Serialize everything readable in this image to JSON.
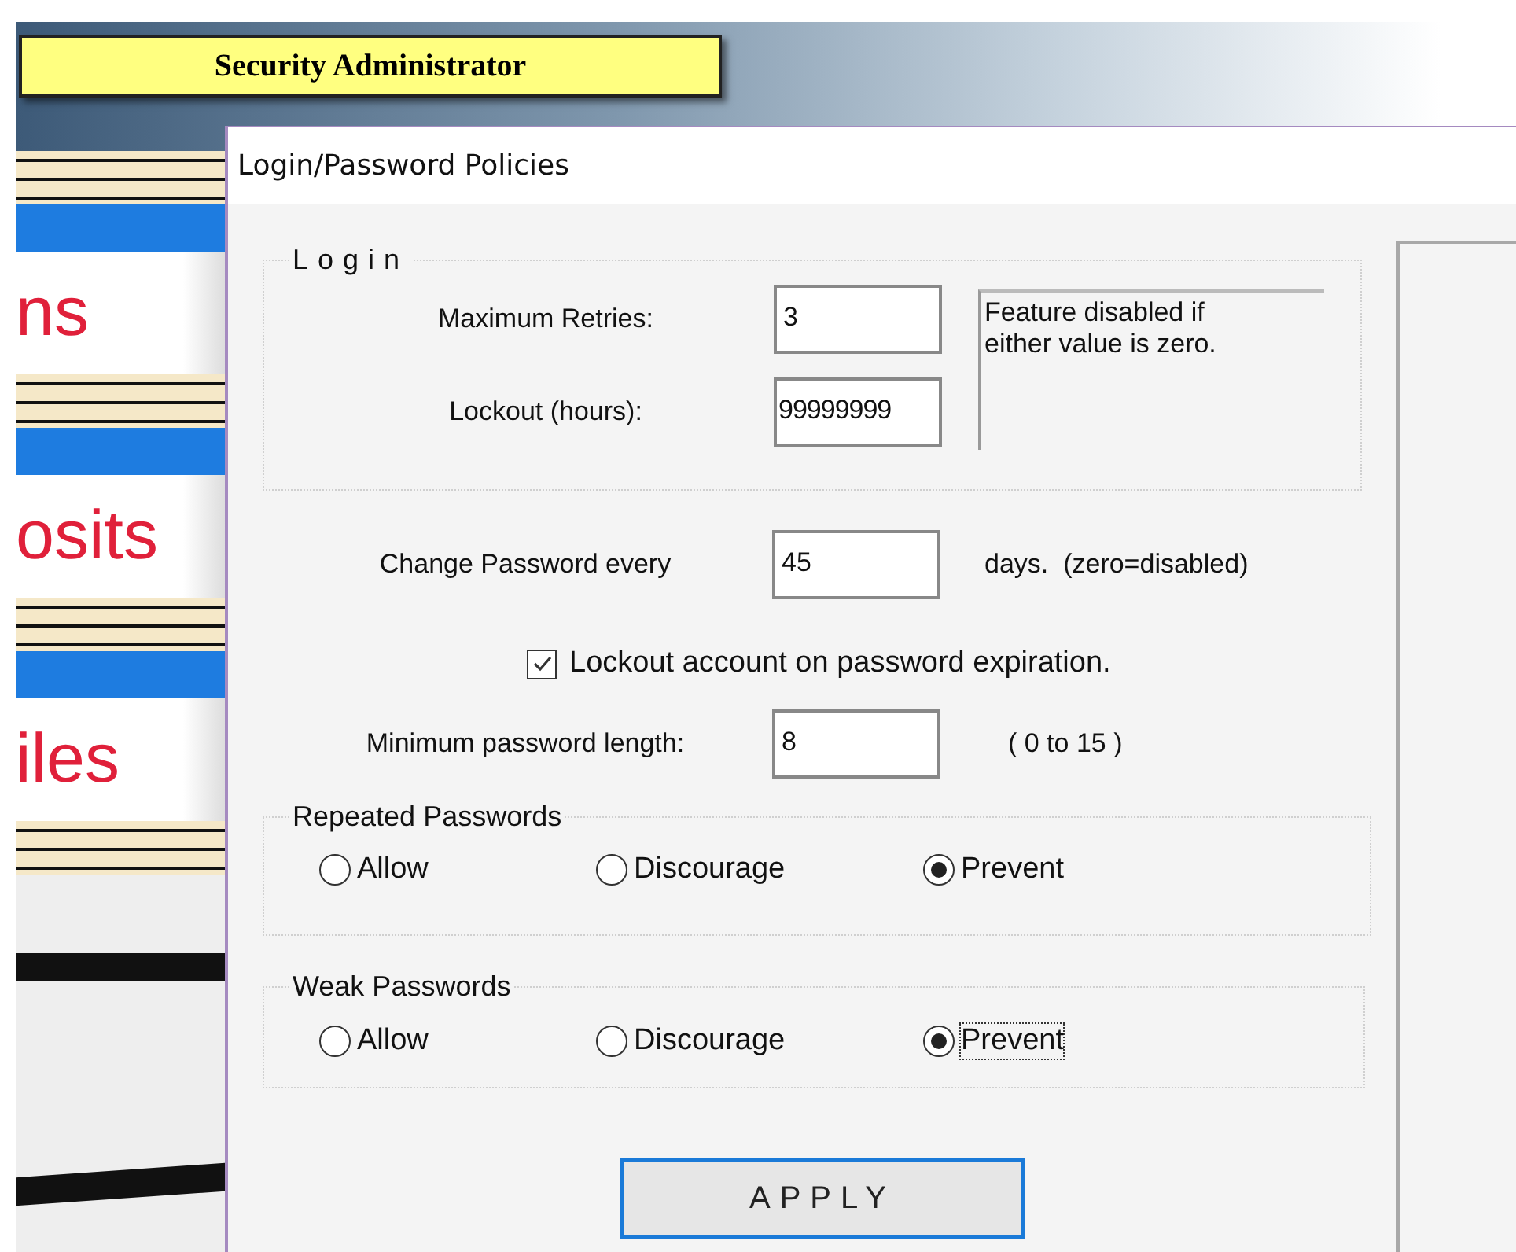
{
  "background_app": {
    "banner": "Security Administrator",
    "menu_items": [
      {
        "label": "ns"
      },
      {
        "label": "osits"
      },
      {
        "label": "iles"
      }
    ]
  },
  "dialog": {
    "title": "Login/Password Policies",
    "login_group": {
      "legend": "Login",
      "max_retries": {
        "label": "Maximum Retries:",
        "value": "3"
      },
      "lockout_hours": {
        "label": "Lockout (hours):",
        "value": "99999999"
      },
      "note": "Feature disabled if either value is zero."
    },
    "change_password": {
      "label": "Change Password every",
      "value": "45",
      "suffix": "days.  (zero=disabled)"
    },
    "lockout_on_expiration": {
      "label": "Lockout account on password expiration.",
      "checked": true
    },
    "min_length": {
      "label": "Minimum password length:",
      "value": "8",
      "hint": "( 0 to 15 )"
    },
    "radio_groups": [
      {
        "legend": "Repeated Passwords",
        "options": [
          {
            "label": "Allow",
            "selected": false,
            "focused": false
          },
          {
            "label": "Discourage",
            "selected": false,
            "focused": false
          },
          {
            "label": "Prevent",
            "selected": true,
            "focused": false
          }
        ]
      },
      {
        "legend": "Weak Passwords",
        "options": [
          {
            "label": "Allow",
            "selected": false,
            "focused": false
          },
          {
            "label": "Discourage",
            "selected": false,
            "focused": false
          },
          {
            "label": "Prevent",
            "selected": true,
            "focused": true
          }
        ]
      }
    ],
    "apply_button": "APPLY"
  }
}
